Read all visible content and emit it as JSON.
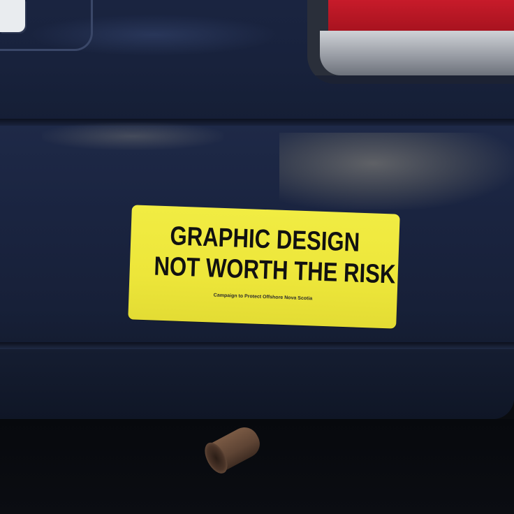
{
  "sticker": {
    "line1": "GRAPHIC DESIGN",
    "line2": "NOT WORTH THE RISK",
    "credit": "Campaign to Protect Offshore Nova Scotia",
    "background_color": "#efe93e",
    "text_color": "#111111"
  },
  "vehicle": {
    "paint_color": "#1a2440",
    "tail_light_color": "#c71b2a",
    "exhaust_color": "#6b4d3a"
  }
}
